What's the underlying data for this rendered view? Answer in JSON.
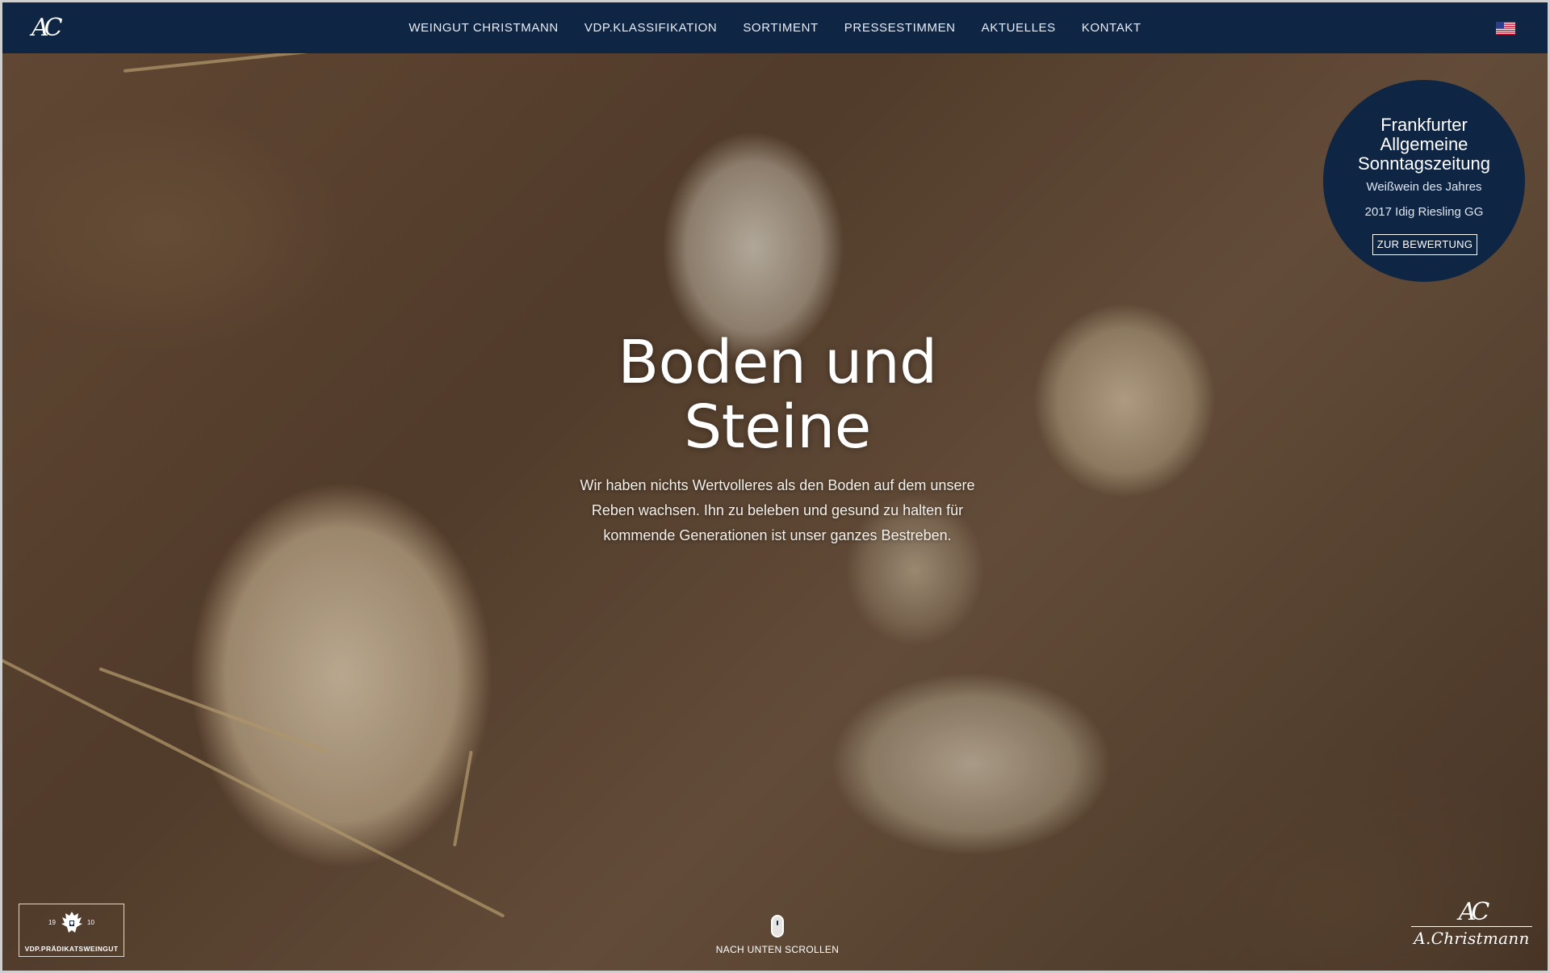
{
  "nav": {
    "logo_text": "AC",
    "items": [
      {
        "label": "WEINGUT CHRISTMANN"
      },
      {
        "label": "VDP.KLASSIFIKATION"
      },
      {
        "label": "SORTIMENT"
      },
      {
        "label": "PRESSESTIMMEN"
      },
      {
        "label": "AKTUELLES"
      },
      {
        "label": "KONTAKT"
      }
    ],
    "language_icon": "us-flag-icon",
    "bar_color": "#0f2544"
  },
  "hero": {
    "title_line1": "Boden und",
    "title_line2": "Steine",
    "text": "Wir haben nichts Wertvolleres als den Boden auf dem unsere Reben wachsen. Ihn zu beleben und gesund zu halten für kommende Generationen ist unser ganzes Bestreben."
  },
  "badge": {
    "title_line1": "Frankfurter",
    "title_line2": "Allgemeine",
    "title_line3": "Sonntagszeitung",
    "subtitle": "Weißwein des Jahres",
    "wine": "2017 Idig Riesling GG",
    "button_label": "ZUR BEWERTUNG"
  },
  "vdp": {
    "year_left": "19",
    "year_right": "10",
    "label": "VDP.PRÄDIKATSWEINGUT"
  },
  "scroll": {
    "label": "NACH UNTEN SCROLLEN"
  },
  "signature": {
    "monogram": "AC",
    "name": "A.Christmann"
  }
}
